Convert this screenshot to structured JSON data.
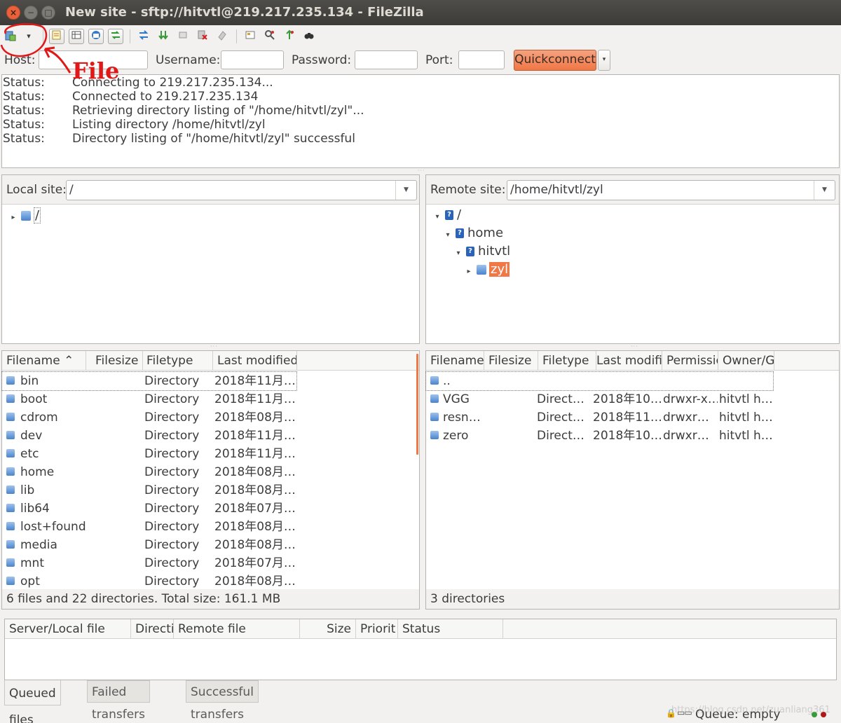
{
  "window": {
    "title": "New site - sftp://hitvtl@219.217.235.134 - FileZilla",
    "close_glyph": "×",
    "min_glyph": "−",
    "max_glyph": "□"
  },
  "toolbar": {
    "icons": [
      "site-manager-icon",
      "dropdown-arrow-icon",
      "message-log-icon",
      "local-tree-icon",
      "remote-tree-icon",
      "transfer-queue-icon",
      "refresh-icon",
      "process-queue-icon",
      "cancel-icon",
      "disconnect-icon",
      "reconnect-icon",
      "filter-icon",
      "compare-icon",
      "sync-browse-icon",
      "search-icon"
    ],
    "dropdown_glyph": "▾"
  },
  "quickconnect": {
    "host_label": "Host:",
    "username_label": "Username:",
    "password_label": "Password:",
    "port_label": "Port:",
    "host_value": "",
    "username_value": "",
    "password_value": "",
    "port_value": "",
    "button_label": "Quickconnect",
    "dropdown_glyph": "▾"
  },
  "annotation": {
    "label": "File",
    "color": "#e01818"
  },
  "log": [
    {
      "type": "Status:",
      "message": "Connecting to 219.217.235.134..."
    },
    {
      "type": "Status:",
      "message": "Connected to 219.217.235.134"
    },
    {
      "type": "Status:",
      "message": "Retrieving directory listing of \"/home/hitvtl/zyl\"..."
    },
    {
      "type": "Status:",
      "message": "Listing directory /home/hitvtl/zyl"
    },
    {
      "type": "Status:",
      "message": "Directory listing of \"/home/hitvtl/zyl\" successful"
    }
  ],
  "local": {
    "site_label": "Local site:",
    "path": "/",
    "tree": [
      {
        "name": "/",
        "expander": "▸"
      }
    ],
    "columns": [
      "Filename",
      "Filesize",
      "Filetype",
      "Last modified"
    ],
    "sort_glyph": "⌃",
    "files": [
      {
        "name": "bin",
        "size": "",
        "type": "Directory",
        "modified": "2018年11月…"
      },
      {
        "name": "boot",
        "size": "",
        "type": "Directory",
        "modified": "2018年11月…"
      },
      {
        "name": "cdrom",
        "size": "",
        "type": "Directory",
        "modified": "2018年08月…"
      },
      {
        "name": "dev",
        "size": "",
        "type": "Directory",
        "modified": "2018年11月…"
      },
      {
        "name": "etc",
        "size": "",
        "type": "Directory",
        "modified": "2018年11月…"
      },
      {
        "name": "home",
        "size": "",
        "type": "Directory",
        "modified": "2018年08月…"
      },
      {
        "name": "lib",
        "size": "",
        "type": "Directory",
        "modified": "2018年08月…"
      },
      {
        "name": "lib64",
        "size": "",
        "type": "Directory",
        "modified": "2018年07月…"
      },
      {
        "name": "lost+found",
        "size": "",
        "type": "Directory",
        "modified": "2018年08月…"
      },
      {
        "name": "media",
        "size": "",
        "type": "Directory",
        "modified": "2018年08月…"
      },
      {
        "name": "mnt",
        "size": "",
        "type": "Directory",
        "modified": "2018年07月…"
      },
      {
        "name": "opt",
        "size": "",
        "type": "Directory",
        "modified": "2018年08月…"
      }
    ],
    "status": "6 files and 22 directories. Total size: 161.1 MB"
  },
  "remote": {
    "site_label": "Remote site:",
    "path": "/home/hitvtl/zyl",
    "tree": [
      {
        "name": "/",
        "expander": "▾",
        "icon": "?"
      },
      {
        "name": "home",
        "expander": "▾",
        "icon": "?"
      },
      {
        "name": "hitvtl",
        "expander": "▾",
        "icon": "?"
      },
      {
        "name": "zyl",
        "expander": "▸",
        "icon": ""
      }
    ],
    "columns": [
      "Filename",
      "Filesize",
      "Filetype",
      "Last modifi",
      "Permissic",
      "Owner/G"
    ],
    "files": [
      {
        "name": "..",
        "size": "",
        "type": "",
        "modified": "",
        "perms": "",
        "owner": ""
      },
      {
        "name": "VGG",
        "size": "",
        "type": "Direct…",
        "modified": "2018年10…",
        "perms": "drwxr-x…",
        "owner": "hitvtl h…"
      },
      {
        "name": "resn…",
        "size": "",
        "type": "Direct…",
        "modified": "2018年11…",
        "perms": "drwxr…",
        "owner": "hitvtl h…"
      },
      {
        "name": "zero",
        "size": "",
        "type": "Direct…",
        "modified": "2018年10…",
        "perms": "drwxr…",
        "owner": "hitvtl h…"
      }
    ],
    "status": "3 directories"
  },
  "queue": {
    "columns": [
      "Server/Local file",
      "Directi",
      "Remote file",
      "Size",
      "Priorit",
      "Status"
    ],
    "tabs": [
      "Queued files",
      "Failed transfers",
      "Successful transfers"
    ],
    "status": "Queue: empty"
  },
  "watermark": "https://blog.csdn.net/zuanliang361"
}
